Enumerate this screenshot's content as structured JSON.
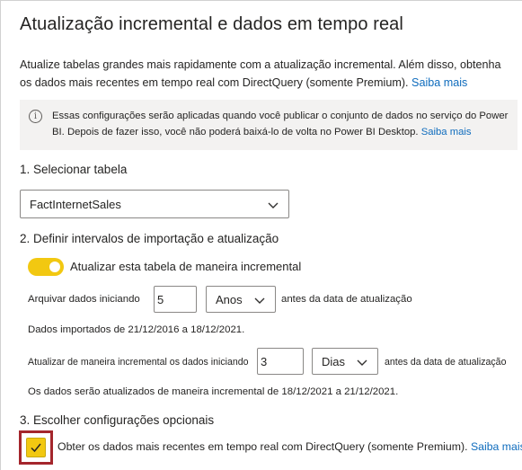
{
  "title": "Atualização incremental e dados em tempo real",
  "intro": {
    "text": "Atualize tabelas grandes mais rapidamente com a atualização incremental. Além disso, obtenha os dados mais recentes em tempo real com DirectQuery (somente Premium).",
    "link": "Saiba mais"
  },
  "info": {
    "icon": "info-icon",
    "text": "Essas configurações serão aplicadas quando você publicar o conjunto de dados no serviço do Power BI. Depois de fazer isso, você não poderá baixá-lo de volta no Power BI Desktop.",
    "link": "Saiba mais"
  },
  "step1": {
    "label": "1. Selecionar tabela",
    "table_value": "FactInternetSales"
  },
  "step2": {
    "label": "2. Definir intervalos de importação e atualização",
    "toggle_label": "Atualizar esta tabela de maneira incremental",
    "toggle_on": true,
    "archive_label": "Arquivar dados iniciando",
    "archive_value": "5",
    "archive_unit": "Anos",
    "archive_suffix": "antes da data de atualização",
    "imported_text": "Dados importados de 21/12/2016 a 18/12/2021.",
    "incremental_label": "Atualizar de maneira incremental os dados iniciando",
    "incremental_value": "3",
    "incremental_unit": "Dias",
    "incremental_suffix": "antes da data de atualização",
    "incremental_text": "Os dados serão atualizados de maneira incremental de 18/12/2021 a 21/12/2021."
  },
  "step3": {
    "label": "3. Escolher configurações opcionais",
    "checkbox_label": "Obter os dados mais recentes em tempo real com DirectQuery (somente Premium).",
    "checkbox_checked": true,
    "link": "Saiba mais"
  },
  "colors": {
    "accent": "#f2c811",
    "link": "#0f6cbd",
    "highlight": "#a4262c"
  }
}
